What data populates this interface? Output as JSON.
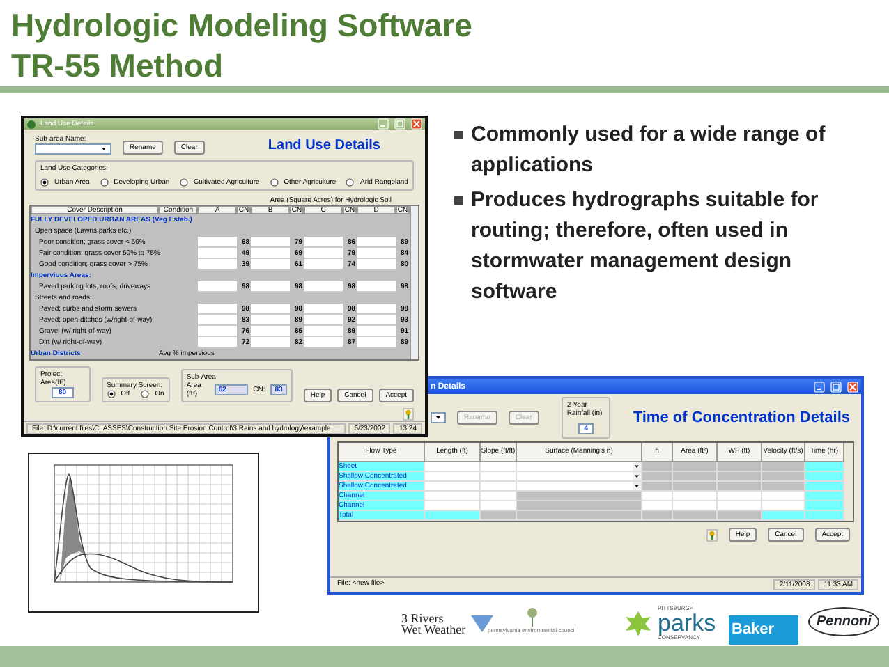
{
  "slide": {
    "title_lines": [
      "Hydrologic Modeling Software",
      "TR-55 Method"
    ],
    "bullets": [
      "Commonly used for a wide range of applications",
      "Produces hydrographs suitable for routing; therefore, often used in stormwater management design software"
    ]
  },
  "land_use_window": {
    "title": "Land Use Details",
    "subarea_label": "Sub-area Name:",
    "top_buttons": [
      "Rename",
      "Clear"
    ],
    "heading": "Land Use Details",
    "categories_label": "Land Use Categories:",
    "categories": [
      {
        "label": "Urban Area",
        "selected": true
      },
      {
        "label": "Developing Urban",
        "selected": false
      },
      {
        "label": "Cultivated Agriculture",
        "selected": false
      },
      {
        "label": "Other Agriculture",
        "selected": false
      },
      {
        "label": "Arid Rangeland",
        "selected": false
      }
    ],
    "area_header": "Area (Square Acres) for Hydrologic Soil",
    "columns": [
      "Cover Description",
      "Condition",
      "A",
      "CN",
      "B",
      "CN",
      "C",
      "CN",
      "D",
      "CN"
    ],
    "rows": [
      {
        "kind": "section",
        "text": "FULLY DEVELOPED URBAN AREAS (Veg Estab.)"
      },
      {
        "kind": "group",
        "text": "Open space (Lawns,parks etc.)"
      },
      {
        "kind": "item",
        "text": "Poor condition; grass cover < 50%",
        "cn": [
          "68",
          "79",
          "86",
          "89"
        ]
      },
      {
        "kind": "item",
        "text": "Fair condition; grass cover 50% to 75%",
        "cn": [
          "49",
          "69",
          "79",
          "84"
        ]
      },
      {
        "kind": "item",
        "text": "Good condition; grass cover > 75%",
        "cn": [
          "39",
          "61",
          "74",
          "80"
        ]
      },
      {
        "kind": "section",
        "text": "Impervious Areas:"
      },
      {
        "kind": "item",
        "text": "Paved parking lots, roofs, driveways",
        "cn": [
          "98",
          "98",
          "98",
          "98"
        ]
      },
      {
        "kind": "group",
        "text": "Streets and roads:"
      },
      {
        "kind": "item",
        "text": "Paved; curbs and storm sewers",
        "cn": [
          "98",
          "98",
          "98",
          "98"
        ]
      },
      {
        "kind": "item",
        "text": "Paved; open ditches (w/right-of-way)",
        "cn": [
          "83",
          "89",
          "92",
          "93"
        ]
      },
      {
        "kind": "item",
        "text": "Gravel (w/ right-of-way)",
        "cn": [
          "76",
          "85",
          "89",
          "91"
        ]
      },
      {
        "kind": "item",
        "text": "Dirt (w/ right-of-way)",
        "cn": [
          "72",
          "82",
          "87",
          "89"
        ]
      },
      {
        "kind": "footer",
        "text": "Urban Districts",
        "condition": "Avg % impervious"
      }
    ],
    "project_area": {
      "label": "Project Area(ft²)",
      "value": "80"
    },
    "summary": {
      "label": "Summary Screen:",
      "options": [
        {
          "label": "Off",
          "selected": true
        },
        {
          "label": "On",
          "selected": false
        }
      ]
    },
    "sub_area": {
      "label": "Sub-Area",
      "area_label": "Area (ft²)",
      "area_value": "62",
      "cn_label": "CN:",
      "cn_value": "83"
    },
    "buttons": [
      "Help",
      "Cancel",
      "Accept"
    ],
    "status_bar": [
      "File: D:\\current files\\CLASSES\\Construction Site Erosion Control\\3 Rains and hydrology\\example",
      "6/23/2002",
      "13:24"
    ]
  },
  "toc_window": {
    "title": "n Details",
    "top_buttons": [
      {
        "label": "Rename",
        "disabled": true
      },
      {
        "label": "Clear",
        "disabled": true
      }
    ],
    "rainfall": {
      "label": "2-Year Rainfall (in)",
      "value": "4"
    },
    "heading": "Time of Concentration Details",
    "columns": [
      "Flow Type",
      "Length (ft)",
      "Slope (ft/ft)",
      "Surface (Manning's n)",
      "n",
      "Area (ft²)",
      "WP (ft)",
      "Velocity (ft/s)",
      "Time (hr)"
    ],
    "rows": [
      {
        "kind": "overland",
        "flow_type": "Sheet"
      },
      {
        "kind": "overland",
        "flow_type": "Shallow Concentrated"
      },
      {
        "kind": "overland",
        "flow_type": "Shallow Concentrated"
      },
      {
        "kind": "channel",
        "flow_type": "Channel"
      },
      {
        "kind": "channel",
        "flow_type": "Channel"
      },
      {
        "kind": "total",
        "flow_type": "Total"
      }
    ],
    "buttons": [
      "Help",
      "Cancel",
      "Accept"
    ],
    "status_bar": [
      "File: <new file>",
      "2/11/2008",
      "11:33 AM"
    ]
  },
  "logos": [
    {
      "kind": "rivers",
      "lines": [
        "3 Rivers",
        "Wet Weather"
      ]
    },
    {
      "kind": "council",
      "lines": [
        "pennsylvania environmental council"
      ]
    },
    {
      "kind": "parks",
      "lines": [
        "PITTSBURGH",
        "parks",
        "CONSERVANCY"
      ]
    },
    {
      "kind": "baker",
      "lines": [
        "Baker"
      ]
    },
    {
      "kind": "pennoni",
      "lines": [
        "Pennoni"
      ]
    }
  ]
}
